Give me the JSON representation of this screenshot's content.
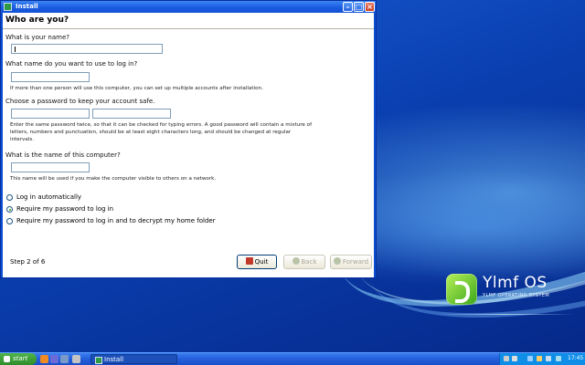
{
  "window": {
    "title": "Install",
    "header": "Who are you?",
    "questions": {
      "name": "What is your name?",
      "login": "What name do you want to use to log in?",
      "login_hint": "If more than one person will use this computer, you can set up multiple accounts after installation.",
      "password": "Choose a password to keep your account safe.",
      "password_hint": "Enter the same password twice, so that it can be checked for typing errors. A good password will contain a mixture of letters, numbers and punctuation, should be at least eight characters long, and should be changed at regular intervals.",
      "computer": "What is the name of this computer?",
      "computer_hint": "This name will be used if you make the computer visible to others on a network."
    },
    "fields": {
      "name_value": "",
      "login_value": "",
      "password_value": "",
      "password_confirm_value": "",
      "computer_value": ""
    },
    "login_options": [
      {
        "label": "Log in automatically",
        "selected": false
      },
      {
        "label": "Require my password to log in",
        "selected": true
      },
      {
        "label": "Require my password to log in and to decrypt my home folder",
        "selected": false
      }
    ],
    "step": "Step 2 of 6",
    "buttons": {
      "quit": "Quit",
      "back": "Back",
      "forward": "Forward"
    }
  },
  "brand": {
    "name": "Ylmf OS",
    "tagline": "YLMF OPERATING SYSTEM"
  },
  "taskbar": {
    "start_label": "start",
    "task_label": "Install",
    "clock": "17:45"
  },
  "colors": {
    "accent": "#245edb",
    "start_green": "#2e8c2a",
    "brand_green": "#3aa61a"
  }
}
